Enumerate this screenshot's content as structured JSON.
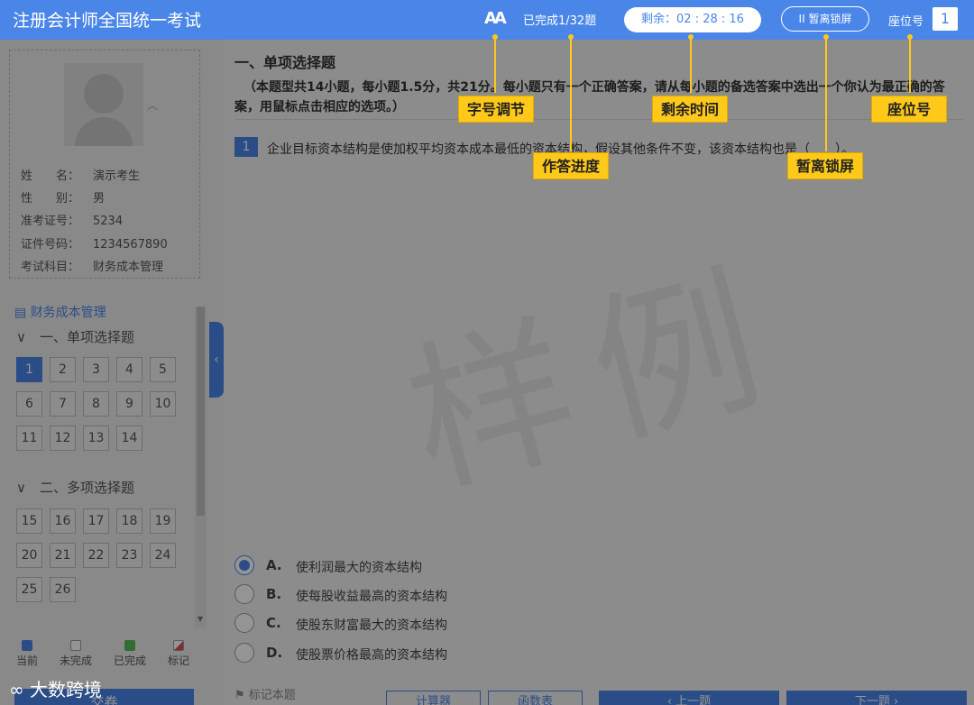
{
  "header": {
    "title": "注册会计师全国统一考试",
    "font_btn": "AA",
    "progress": "已完成1/32题",
    "timer": "剩余：02 : 28 : 16",
    "pause": "II 暂离锁屏",
    "seat_label": "座位号",
    "seat_num": "1"
  },
  "profile": {
    "rows": [
      {
        "label": "姓　　名：",
        "value": "演示考生"
      },
      {
        "label": "性　　别：",
        "value": "男"
      },
      {
        "label": "准考证号：",
        "value": "5234"
      },
      {
        "label": "证件号码：",
        "value": "1234567890"
      },
      {
        "label": "考试科目：",
        "value": "财务成本管理"
      }
    ]
  },
  "nav": {
    "subject": "财务成本管理",
    "section1": "一、单项选择题",
    "section2": "二、多项选择题",
    "q1": [
      "1",
      "2",
      "3",
      "4",
      "5",
      "6",
      "7",
      "8",
      "9",
      "10",
      "11",
      "12",
      "13",
      "14"
    ],
    "q2": [
      "15",
      "16",
      "17",
      "18",
      "19",
      "20",
      "21",
      "22",
      "23",
      "24",
      "25",
      "26"
    ],
    "legend": [
      "当前",
      "未完成",
      "已完成",
      "标记"
    ],
    "submit": "交卷"
  },
  "content": {
    "title": "一、单项选择题",
    "desc": "（本题型共14小题，每小题1.5分，共21分。每小题只有一个正确答案，请从每小题的备选答案中选出一个你认为最正确的答案，用鼠标点击相应的选项。）",
    "q_num": "1",
    "question": "企业目标资本结构是使加权平均资本成本最低的资本结构，假设其他条件不变，该资本结构也是（　　）。",
    "watermark": "样例",
    "options": [
      {
        "letter": "A.",
        "text": "使利润最大的资本结构"
      },
      {
        "letter": "B.",
        "text": "使每股收益最高的资本结构"
      },
      {
        "letter": "C.",
        "text": "使股东财富最大的资本结构"
      },
      {
        "letter": "D.",
        "text": "使股票价格最高的资本结构"
      }
    ],
    "mark": "标记本题",
    "calc": "计算器",
    "formula": "函数表",
    "prev": "上一题",
    "next": "下一题"
  },
  "callouts": {
    "font": "字号调节",
    "progress": "作答进度",
    "timer": "剩余时间",
    "pause": "暂离锁屏",
    "seat": "座位号"
  },
  "logo": "大数跨境",
  "colors": {
    "accent": "#4a86e8",
    "callout": "#ffc91a"
  }
}
